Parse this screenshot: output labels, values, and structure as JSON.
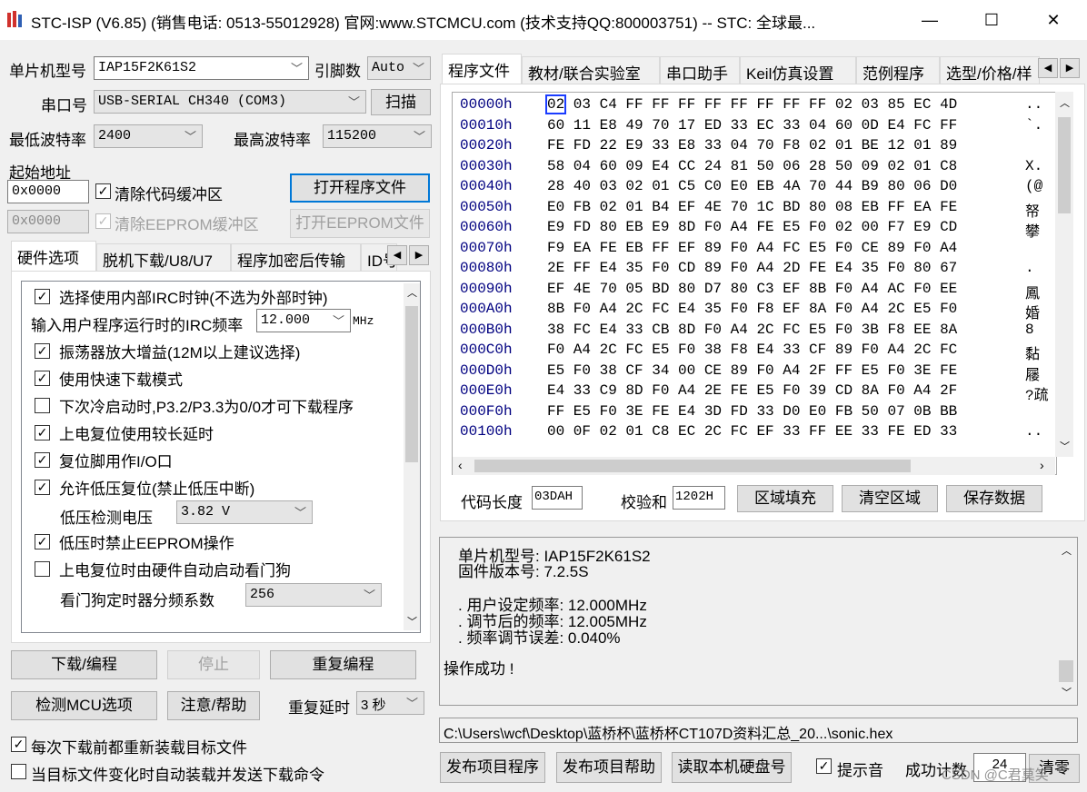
{
  "window": {
    "title": "STC-ISP (V6.85) (销售电话: 0513-55012928) 官网:www.STCMCU.com  (技术支持QQ:800003751)  -- STC: 全球最...",
    "minimize": "—",
    "maximize": "☐",
    "close": "✕",
    "icon": "stc-logo-icon"
  },
  "left": {
    "mcu_label": "单片机型号",
    "mcu_value": "IAP15F2K61S2",
    "pins_label": "引脚数",
    "pins_value": "Auto",
    "port_label": "串口号",
    "port_value": "USB-SERIAL CH340 (COM3)",
    "scan_button": "扫描",
    "min_baud_label": "最低波特率",
    "min_baud_value": "2400",
    "max_baud_label": "最高波特率",
    "max_baud_value": "115200",
    "start_addr_label": "起始地址",
    "code_addr": "0x0000",
    "clear_code_label": "清除代码缓冲区",
    "open_prog_button": "打开程序文件",
    "eeprom_addr": "0x0000",
    "clear_eeprom_label": "清除EEPROM缓冲区",
    "open_eeprom_button": "打开EEPROM文件",
    "tabs": [
      "硬件选项",
      "脱机下载/U8/U7",
      "程序加密后传输",
      "ID号"
    ],
    "options": [
      {
        "label": "选择使用内部IRC时钟(不选为外部时钟)",
        "checked": true
      },
      {
        "label": "振荡器放大增益(12M以上建议选择)",
        "checked": true
      },
      {
        "label": "使用快速下载模式",
        "checked": true
      },
      {
        "label": "下次冷启动时,P3.2/P3.3为0/0才可下载程序",
        "checked": false
      },
      {
        "label": "上电复位使用较长延时",
        "checked": true
      },
      {
        "label": "复位脚用作I/O口",
        "checked": true
      },
      {
        "label": "允许低压复位(禁止低压中断)",
        "checked": true
      },
      {
        "label": "低压时禁止EEPROM操作",
        "checked": true
      },
      {
        "label": "上电复位时由硬件自动启动看门狗",
        "checked": false
      }
    ],
    "irc_label": "输入用户程序运行时的IRC频率",
    "irc_value": "12.000",
    "irc_unit": "MHz",
    "lvd_label": "低压检测电压",
    "lvd_value": "3.82 V",
    "wdt_label": "看门狗定时器分频系数",
    "wdt_value": "256",
    "download_button": "下载/编程",
    "stop_button": "停止",
    "reprogram_button": "重复编程",
    "detect_button": "检测MCU选项",
    "help_button": "注意/帮助",
    "repeat_delay_label": "重复延时",
    "repeat_delay_value": "3 秒",
    "reload_label": "每次下载前都重新装载目标文件",
    "reload_checked": true,
    "auto_label": "当目标文件变化时自动装载并发送下载命令",
    "auto_checked": false
  },
  "right": {
    "tabs": [
      "程序文件",
      "教材/联合实验室",
      "串口助手",
      "Keil仿真设置",
      "范例程序",
      "选型/价格/样"
    ],
    "hex_rows": [
      {
        "addr": "00000h",
        "bytes": "02 03 C4 FF FF FF FF FF FF FF FF 02 03 85 EC 4D",
        "ascii": ".."
      },
      {
        "addr": "00010h",
        "bytes": "60 11 E8 49 70 17 ED 33 EC 33 04 60 0D E4 FC FF",
        "ascii": "`."
      },
      {
        "addr": "00020h",
        "bytes": "FE FD 22 E9 33 E8 33 04 70 F8 02 01 BE 12 01 89",
        "ascii": ""
      },
      {
        "addr": "00030h",
        "bytes": "58 04 60 09 E4 CC 24 81 50 06 28 50 09 02 01 C8",
        "ascii": "X."
      },
      {
        "addr": "00040h",
        "bytes": "28 40 03 02 01 C5 C0 E0 EB 4A 70 44 B9 80 06 D0",
        "ascii": "(@"
      },
      {
        "addr": "00050h",
        "bytes": "E0 FB 02 01 B4 EF 4E 70 1C BD 80 08 EB FF EA FE",
        "ascii": "帑"
      },
      {
        "addr": "00060h",
        "bytes": "E9 FD 80 EB E9 8D F0 A4 FE E5 F0 02 00 F7 E9 CD",
        "ascii": "攀"
      },
      {
        "addr": "00070h",
        "bytes": "F9 EA FE EB FF EF 89 F0 A4 FC E5 F0 CE 89 F0 A4",
        "ascii": ""
      },
      {
        "addr": "00080h",
        "bytes": "2E FF E4 35 F0 CD 89 F0 A4 2D FE E4 35 F0 80 67",
        "ascii": "."
      },
      {
        "addr": "00090h",
        "bytes": "EF 4E 70 05 BD 80 D7 80 C3 EF 8B F0 A4 AC F0 EE",
        "ascii": "鳳"
      },
      {
        "addr": "000A0h",
        "bytes": "8B F0 A4 2C FC E4 35 F0 F8 EF 8A F0 A4 2C E5 F0",
        "ascii": "婚"
      },
      {
        "addr": "000B0h",
        "bytes": "38 FC E4 33 CB 8D F0 A4 2C FC E5 F0 3B F8 EE 8A",
        "ascii": "8"
      },
      {
        "addr": "000C0h",
        "bytes": "F0 A4 2C FC E5 F0 38 F8 E4 33 CF 89 F0 A4 2C FC",
        "ascii": "黏"
      },
      {
        "addr": "000D0h",
        "bytes": "E5 F0 38 CF 34 00 CE 89 F0 A4 2F FF E5 F0 3E FE",
        "ascii": "屦"
      },
      {
        "addr": "000E0h",
        "bytes": "E4 33 C9 8D F0 A4 2E FE E5 F0 39 CD 8A F0 A4 2F",
        "ascii": "?疏"
      },
      {
        "addr": "000F0h",
        "bytes": "FF E5 F0 3E FE E4 3D FD 33 D0 E0 FB 50 07 0B BB",
        "ascii": ""
      },
      {
        "addr": "00100h",
        "bytes": "00 0F 02 01 C8 EC 2C FC EF 33 FF EE 33 FE ED 33",
        "ascii": ".."
      }
    ],
    "code_len_label": "代码长度",
    "code_len_value": "03DAH",
    "checksum_label": "校验和",
    "checksum_value": "1202H",
    "fill_button": "区域填充",
    "clear_button": "清空区域",
    "save_button": "保存数据",
    "log": {
      "line1": "单片机型号: IAP15F2K61S2",
      "line2": "固件版本号: 7.2.5S",
      "line3": ".  用户设定频率: 12.000MHz",
      "line4": ".  调节后的频率: 12.005MHz",
      "line5": ".  频率调节误差: 0.040%",
      "line6": "操作成功 !"
    },
    "file_path": "C:\\Users\\wcf\\Desktop\\蓝桥杯\\蓝桥杯CT107D资料汇总_20...\\sonic.hex",
    "publish_prog_button": "发布项目程序",
    "publish_help_button": "发布项目帮助",
    "read_disk_button": "读取本机硬盘号",
    "beep_label": "提示音",
    "beep_checked": true,
    "success_count_label": "成功计数",
    "success_count_value": "24",
    "clear_count_button": "清零",
    "watermark": "CSDN @C君莫笑"
  }
}
